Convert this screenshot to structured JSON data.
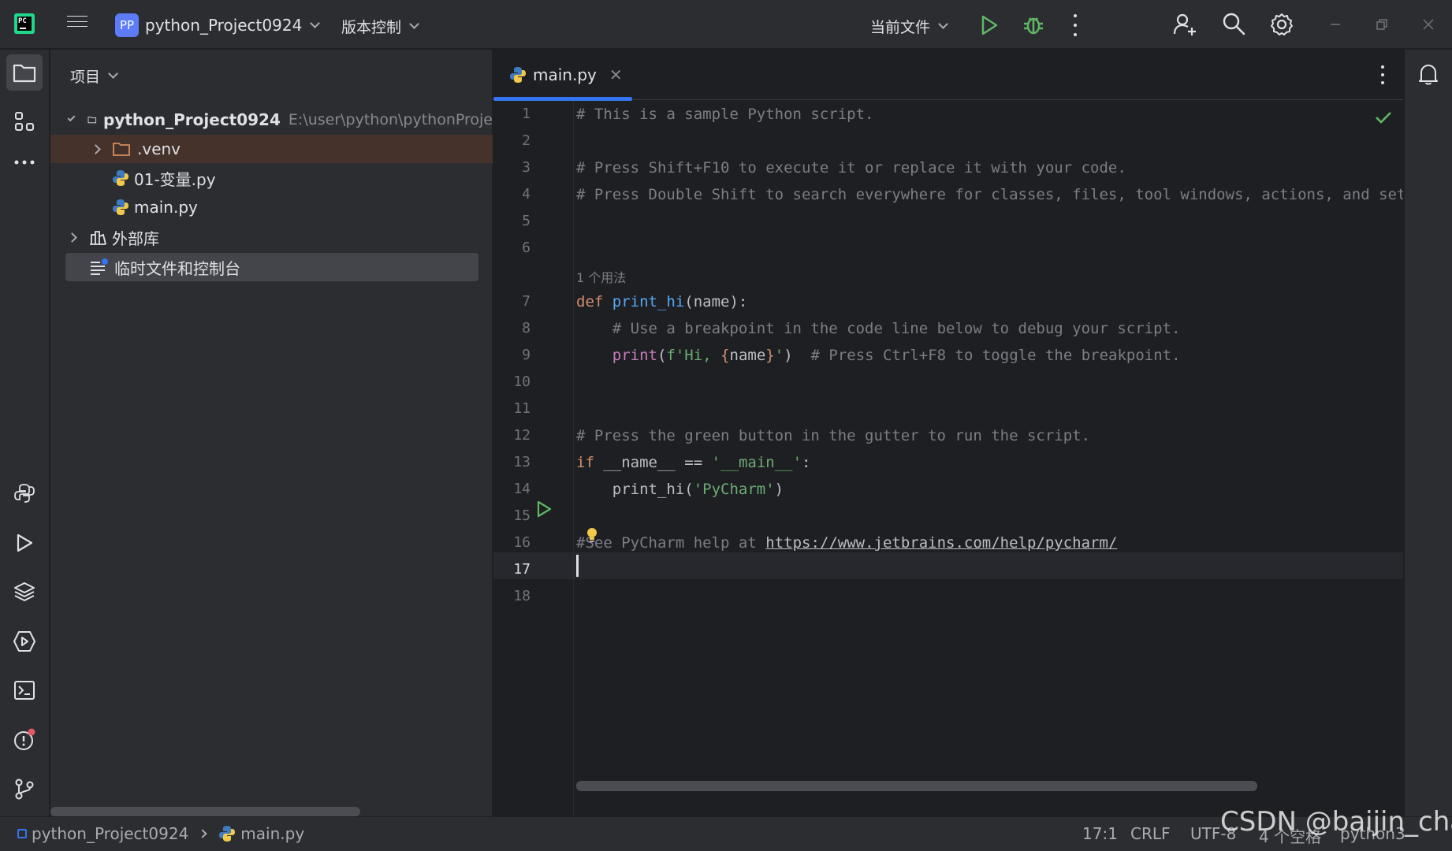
{
  "titlebar": {
    "logo_text": "PC",
    "project_badge": "PP",
    "project_name": "python_Project0924",
    "vcs_label": "版本控制",
    "run_config": "当前文件"
  },
  "project_panel": {
    "header": "项目",
    "root": {
      "name": "python_Project0924",
      "path": "E:\\user\\python\\pythonProje"
    },
    "items": [
      {
        "label": ".venv"
      },
      {
        "label": "01-变量.py"
      },
      {
        "label": "main.py"
      },
      {
        "label": "外部库"
      },
      {
        "label": "临时文件和控制台"
      }
    ]
  },
  "editor": {
    "tab_label": "main.py",
    "inlay_hint": "1 个用法",
    "line_numbers": [
      "1",
      "2",
      "3",
      "4",
      "5",
      "6",
      "7",
      "8",
      "9",
      "10",
      "11",
      "12",
      "13",
      "14",
      "15",
      "16",
      "17",
      "18"
    ],
    "current_line": "17",
    "lines": {
      "l1": "# This is a sample Python script.",
      "l3": "# Press Shift+F10 to execute it or replace it with your code.",
      "l4": "# Press Double Shift to search everywhere for classes, files, tool windows, actions, and settings.",
      "l7_kw": "def",
      "l7_fn": "print_hi",
      "l7_rest": "(name):",
      "l8": "# Use a breakpoint in the code line below to debug your script.",
      "l9_fn": "print",
      "l9_p1": "(",
      "l9_s1": "f'Hi, ",
      "l9_b1": "{",
      "l9_var": "name",
      "l9_b2": "}",
      "l9_s2": "'",
      "l9_p2": ")",
      "l9_cm": "# Press Ctrl+F8 to toggle the breakpoint.",
      "l12": "# Press the green button in the gutter to run the script.",
      "l13_kw": "if",
      "l13_mid": "__name__ ==",
      "l13_str": "'__main__'",
      "l13_end": ":",
      "l14_fn": "print_hi(",
      "l14_str": "'PyCharm'",
      "l14_end": ")",
      "l16_hash": "#",
      "l16_text": "See PyCharm help at",
      "l16_url": "https://www.jetbrains.com/help/pycharm/"
    }
  },
  "statusbar": {
    "project": "python_Project0924",
    "file": "main.py",
    "position": "17:1",
    "line_sep": "CRLF",
    "encoding": "UTF-8",
    "indent": "4 个空格",
    "interpreter": "python3"
  },
  "watermark": "CSDN @baijin_cha",
  "colors": {
    "accent": "#3574f0",
    "run": "#5fb865",
    "keyword": "#cf8e6d",
    "function": "#56a8f5",
    "string": "#6aab73"
  }
}
